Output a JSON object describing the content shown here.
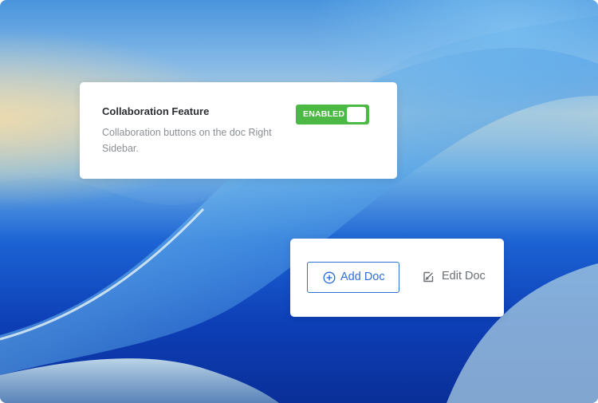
{
  "collaboration_card": {
    "title": "Collaboration Feature",
    "description": "Collaboration buttons on the doc Right Sidebar.",
    "toggle": {
      "label": "ENABLED",
      "enabled": true,
      "color": "#4cb944"
    }
  },
  "actions_card": {
    "add_doc": {
      "label": "Add Doc",
      "icon": "plus-circle-icon",
      "color": "#2f6fd6"
    },
    "edit_doc": {
      "label": "Edit Doc",
      "icon": "edit-icon",
      "color": "#6a6f74"
    }
  }
}
